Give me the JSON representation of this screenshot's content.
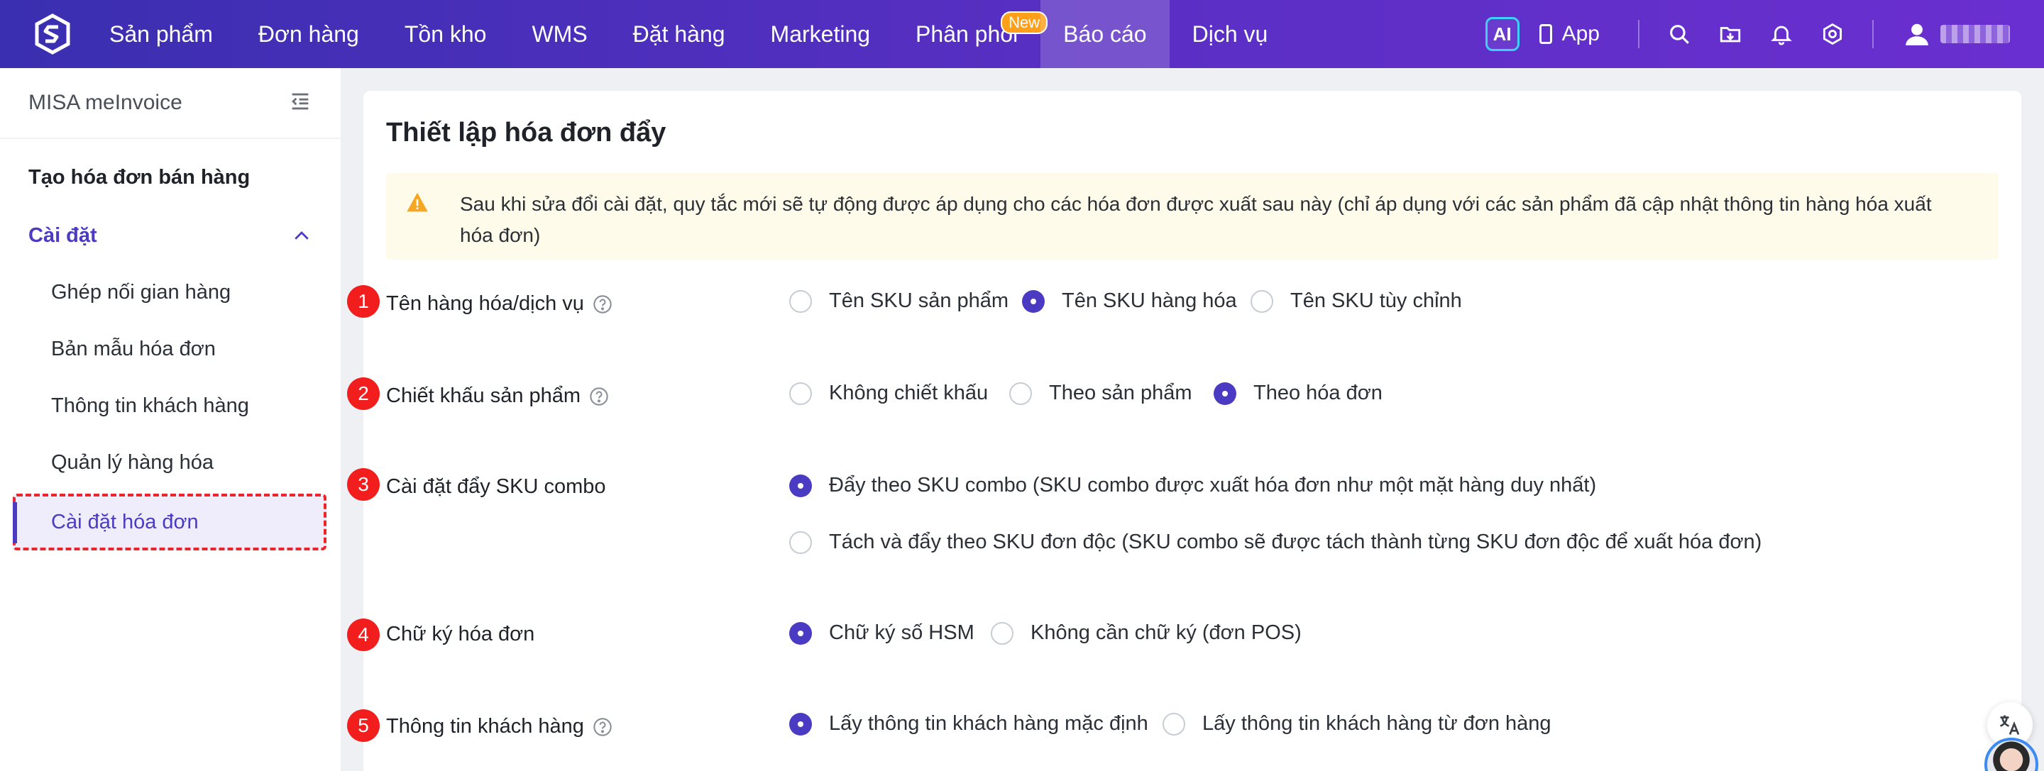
{
  "topnav": {
    "items": [
      {
        "label": "Sản phẩm"
      },
      {
        "label": "Đơn hàng"
      },
      {
        "label": "Tồn kho"
      },
      {
        "label": "WMS"
      },
      {
        "label": "Đặt hàng"
      },
      {
        "label": "Marketing"
      },
      {
        "label": "Phân phối",
        "badge": "New"
      },
      {
        "label": "Báo cáo",
        "active": true
      },
      {
        "label": "Dịch vụ"
      }
    ],
    "ai_label": "AI",
    "app_label": "App",
    "icons": [
      "search-icon",
      "folder-download-icon",
      "bell-icon",
      "gear-icon",
      "user-icon"
    ]
  },
  "sidebar": {
    "title": "MISA meInvoice",
    "create_link": "Tạo hóa đơn bán hàng",
    "group_label": "Cài đặt",
    "items": [
      {
        "label": "Ghép nối gian hàng"
      },
      {
        "label": "Bản mẫu hóa đơn"
      },
      {
        "label": "Thông tin khách hàng"
      },
      {
        "label": "Quản lý hàng hóa"
      },
      {
        "label": "Cài đặt hóa đơn",
        "active": true
      }
    ]
  },
  "main": {
    "title": "Thiết lập hóa đơn đẩy",
    "notice": "Sau khi sửa đổi cài đặt, quy tắc mới sẽ tự động được áp dụng cho các hóa đơn được xuất sau này (chỉ áp dụng với các sản phẩm đã cập nhật thông tin hàng hóa xuất hóa đơn)",
    "settings": [
      {
        "number": "1",
        "label": "Tên hàng hóa/dịch vụ",
        "help": true,
        "options": [
          {
            "label": "Tên SKU sản phẩm",
            "selected": false
          },
          {
            "label": "Tên SKU hàng hóa",
            "selected": true
          },
          {
            "label": "Tên SKU tùy chỉnh",
            "selected": false
          }
        ]
      },
      {
        "number": "2",
        "label": "Chiết khấu sản phẩm",
        "help": true,
        "options": [
          {
            "label": "Không chiết khấu",
            "selected": false
          },
          {
            "label": "Theo sản phẩm",
            "selected": false
          },
          {
            "label": "Theo hóa đơn",
            "selected": true
          }
        ]
      },
      {
        "number": "3",
        "label": "Cài đặt đẩy SKU combo",
        "help": false,
        "options": [
          {
            "label": "Đẩy theo SKU combo (SKU combo được xuất hóa đơn như một mặt hàng duy nhất)",
            "selected": true
          },
          {
            "label": "Tách và đẩy theo SKU đơn độc (SKU combo sẽ được tách thành từng SKU đơn độc để xuất hóa đơn)",
            "selected": false
          }
        ]
      },
      {
        "number": "4",
        "label": "Chữ ký hóa đơn",
        "help": false,
        "options": [
          {
            "label": "Chữ ký số HSM",
            "selected": true
          },
          {
            "label": "Không cần chữ ký (đơn POS)",
            "selected": false
          }
        ]
      },
      {
        "number": "5",
        "label": "Thông tin khách hàng",
        "help": true,
        "options": [
          {
            "label": "Lấy thông tin khách hàng mặc định",
            "selected": true
          },
          {
            "label": "Lấy thông tin khách hàng từ đơn hàng",
            "selected": false
          }
        ]
      }
    ]
  },
  "colors": {
    "nav_gradient_start": "#3a2fb0",
    "nav_gradient_end": "#6a2fd0",
    "accent": "#4a3bc2",
    "badge_red": "#f21d1d",
    "notice_bg": "#fffbea",
    "warning": "#f5a623"
  }
}
